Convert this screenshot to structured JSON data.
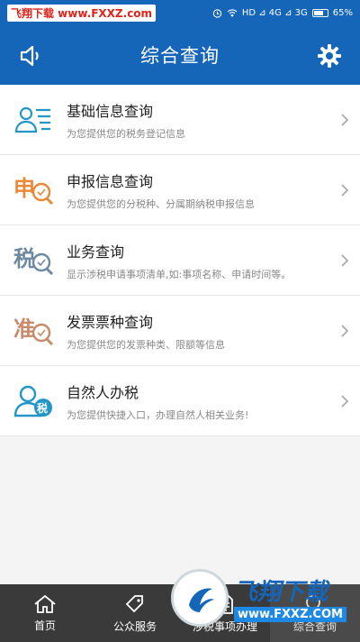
{
  "status_bar": {
    "watermark": "飞翔下载 www.FXXZ.com",
    "network": "HD ⊿ 4G ⊿ 3G",
    "battery": "65%"
  },
  "header": {
    "title": "综合查询",
    "left_icon": "speaker-icon",
    "right_icon": "gear-icon"
  },
  "items": [
    {
      "title": "基础信息查询",
      "subtitle": "为您提供您的税务登记信息",
      "icon": "id-card-icon",
      "icon_char": ""
    },
    {
      "title": "申报信息查询",
      "subtitle": "为您提供您的分税种、分属期纳税申报信息",
      "icon": "shen-search-icon",
      "icon_char": "申"
    },
    {
      "title": "业务查询",
      "subtitle": "显示涉税申请事项清单,如:事项名称、申请时间等。",
      "icon": "shui-search-icon",
      "icon_char": "税"
    },
    {
      "title": "发票票种查询",
      "subtitle": "为您提供您的发票种类、限额等信息",
      "icon": "zhun-search-icon",
      "icon_char": "准"
    },
    {
      "title": "自然人办税",
      "subtitle": "为您提供快捷入口，办理自然人相关业务!",
      "icon": "person-tax-icon",
      "icon_char": "税"
    }
  ],
  "tabs": [
    {
      "label": "首页",
      "icon": "home-icon"
    },
    {
      "label": "公众服务",
      "icon": "tag-icon"
    },
    {
      "label": "涉税事项办理",
      "icon": "document-icon"
    },
    {
      "label": "综合查询",
      "icon": "search-icon"
    }
  ],
  "logo": {
    "name": "飞翔下载",
    "url": "www.FXXZ.COM"
  },
  "colors": {
    "primary": "#1565b8",
    "orange": "#e8893a",
    "teal": "#2196c7",
    "tabbar": "#3a3a3a"
  }
}
